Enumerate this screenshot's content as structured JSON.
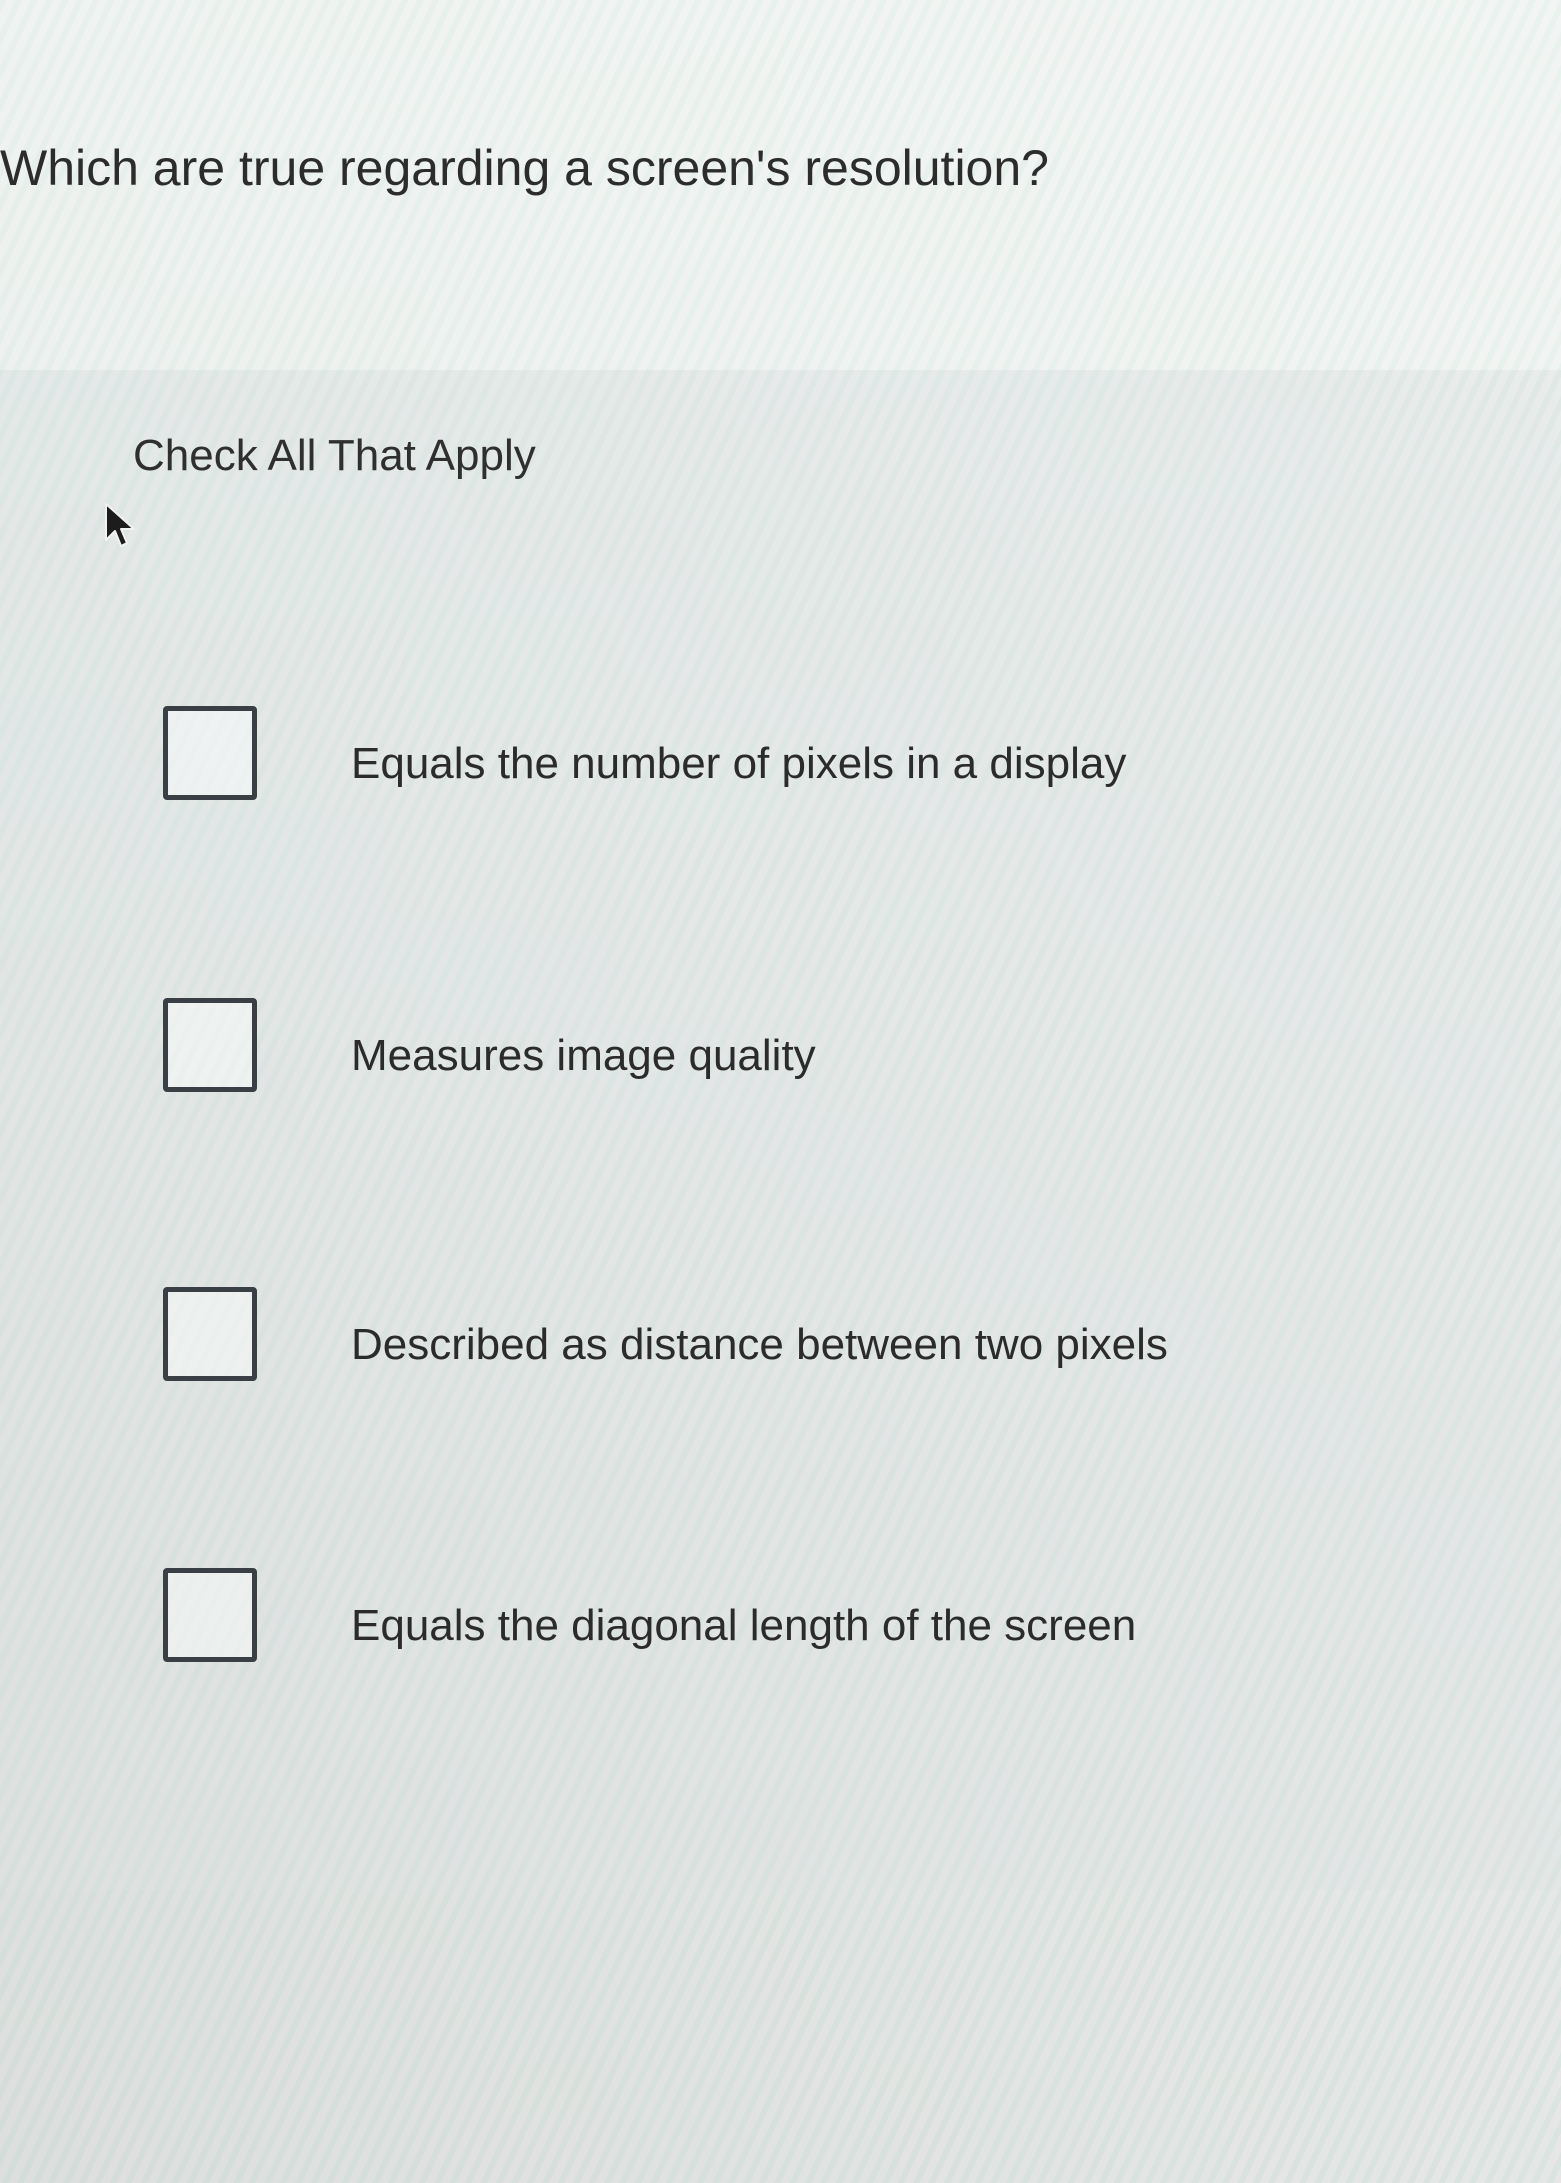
{
  "question": {
    "text": "Which are true regarding a screen's resolution?"
  },
  "instruction": "Check All That Apply",
  "options": [
    {
      "label": "Equals the number of pixels in a display",
      "checked": false
    },
    {
      "label": "Measures image quality",
      "checked": false
    },
    {
      "label": "Described as distance between two pixels",
      "checked": false
    },
    {
      "label": "Equals the diagonal length of the screen",
      "checked": false
    }
  ],
  "icons": {
    "cursor": "mouse-pointer-icon",
    "checkbox": "checkbox-empty-icon"
  },
  "colors": {
    "text": "#2b2b2b",
    "checkbox_border": "#3a3f45"
  }
}
